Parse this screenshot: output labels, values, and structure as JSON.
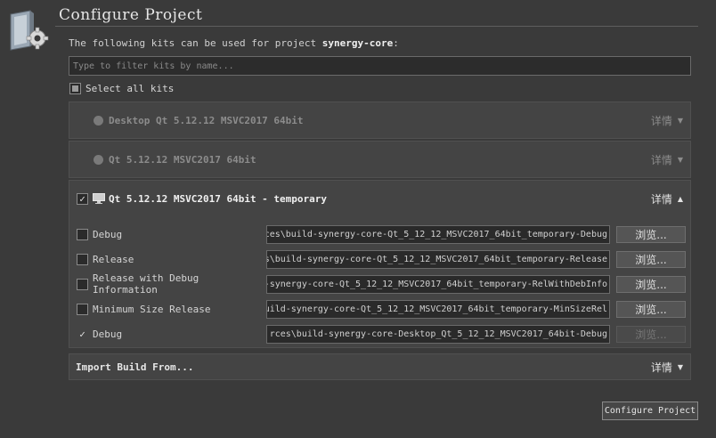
{
  "header": {
    "title": "Configure Project",
    "intro_prefix": "The following kits can be used for project ",
    "project": "synergy-core",
    "intro_suffix": ":"
  },
  "filter": {
    "placeholder": "Type to filter kits by name..."
  },
  "select_all": {
    "label": "Select all kits"
  },
  "kits": [
    {
      "name": "Desktop Qt 5.12.12 MSVC2017 64bit",
      "details": "详情"
    },
    {
      "name": "Qt 5.12.12 MSVC2017 64bit",
      "details": "详情"
    },
    {
      "name": "Qt 5.12.12 MSVC2017 64bit - temporary",
      "details": "详情",
      "builds": [
        {
          "label": "Debug",
          "path": "ces\\build-synergy-core-Qt_5_12_12_MSVC2017_64bit_temporary-Debug",
          "browse": "浏览..."
        },
        {
          "label": "Release",
          "path": "s\\build-synergy-core-Qt_5_12_12_MSVC2017_64bit_temporary-Release",
          "browse": "浏览..."
        },
        {
          "label": "Release with Debug Information",
          "path": "-synergy-core-Qt_5_12_12_MSVC2017_64bit_temporary-RelWithDebInfo",
          "browse": "浏览..."
        },
        {
          "label": "Minimum Size Release",
          "path": "uild-synergy-core-Qt_5_12_12_MSVC2017_64bit_temporary-MinSizeRel",
          "browse": "浏览..."
        },
        {
          "label": "Debug",
          "path": "rces\\build-synergy-core-Desktop_Qt_5_12_12_MSVC2017_64bit-Debug",
          "browse": "浏览..."
        }
      ]
    }
  ],
  "import": {
    "label": "Import Build From...",
    "details": "详情"
  },
  "configure_button": "Configure Project",
  "colors": {
    "background": "#3a3a3a",
    "panel": "#444444",
    "field": "#2a2a2a"
  }
}
